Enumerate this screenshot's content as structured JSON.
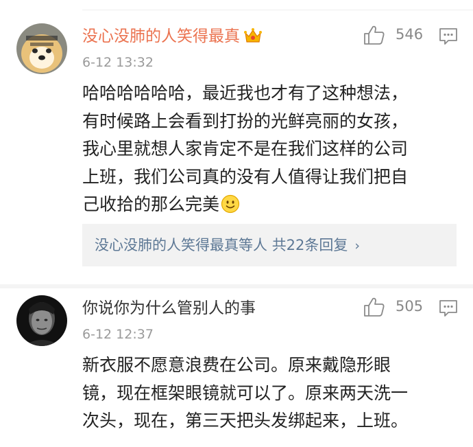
{
  "comments": [
    {
      "username": "没心没肺的人笑得最真",
      "is_vip": true,
      "avatar_icon": "dog-avatar",
      "time": "6-12 13:32",
      "likes": "546",
      "text_lines": [
        "哈哈哈哈哈哈，最近我也才有了这种想法，",
        "有时候路上会看到打扮的光鲜亮丽的女孩，",
        "我心里就想人家肯定不是在我们这样的公司",
        "上班，我们公司真的没有人值得让我们把自",
        "己收拾的那么完美"
      ],
      "replies": {
        "name": "没心没肺的人笑得最真",
        "suffix": "等人",
        "count_text": "共22条回复",
        "chevron": "›"
      }
    },
    {
      "username": "你说你为什么管别人的事",
      "is_vip": false,
      "avatar_icon": "man-portrait-avatar",
      "time": "6-12 12:37",
      "likes": "505",
      "text_lines": [
        "新衣服不愿意浪费在公司。原来戴隐形眼",
        "镜，现在框架眼镜就可以了。原来两天洗一",
        "次头，现在，第三天把头发绑起来，上班。"
      ]
    }
  ],
  "colors": {
    "vip_name": "#eb7350",
    "link": "#5d7895",
    "meta": "#9a9a9a",
    "reply_bg": "#f2f2f2"
  }
}
